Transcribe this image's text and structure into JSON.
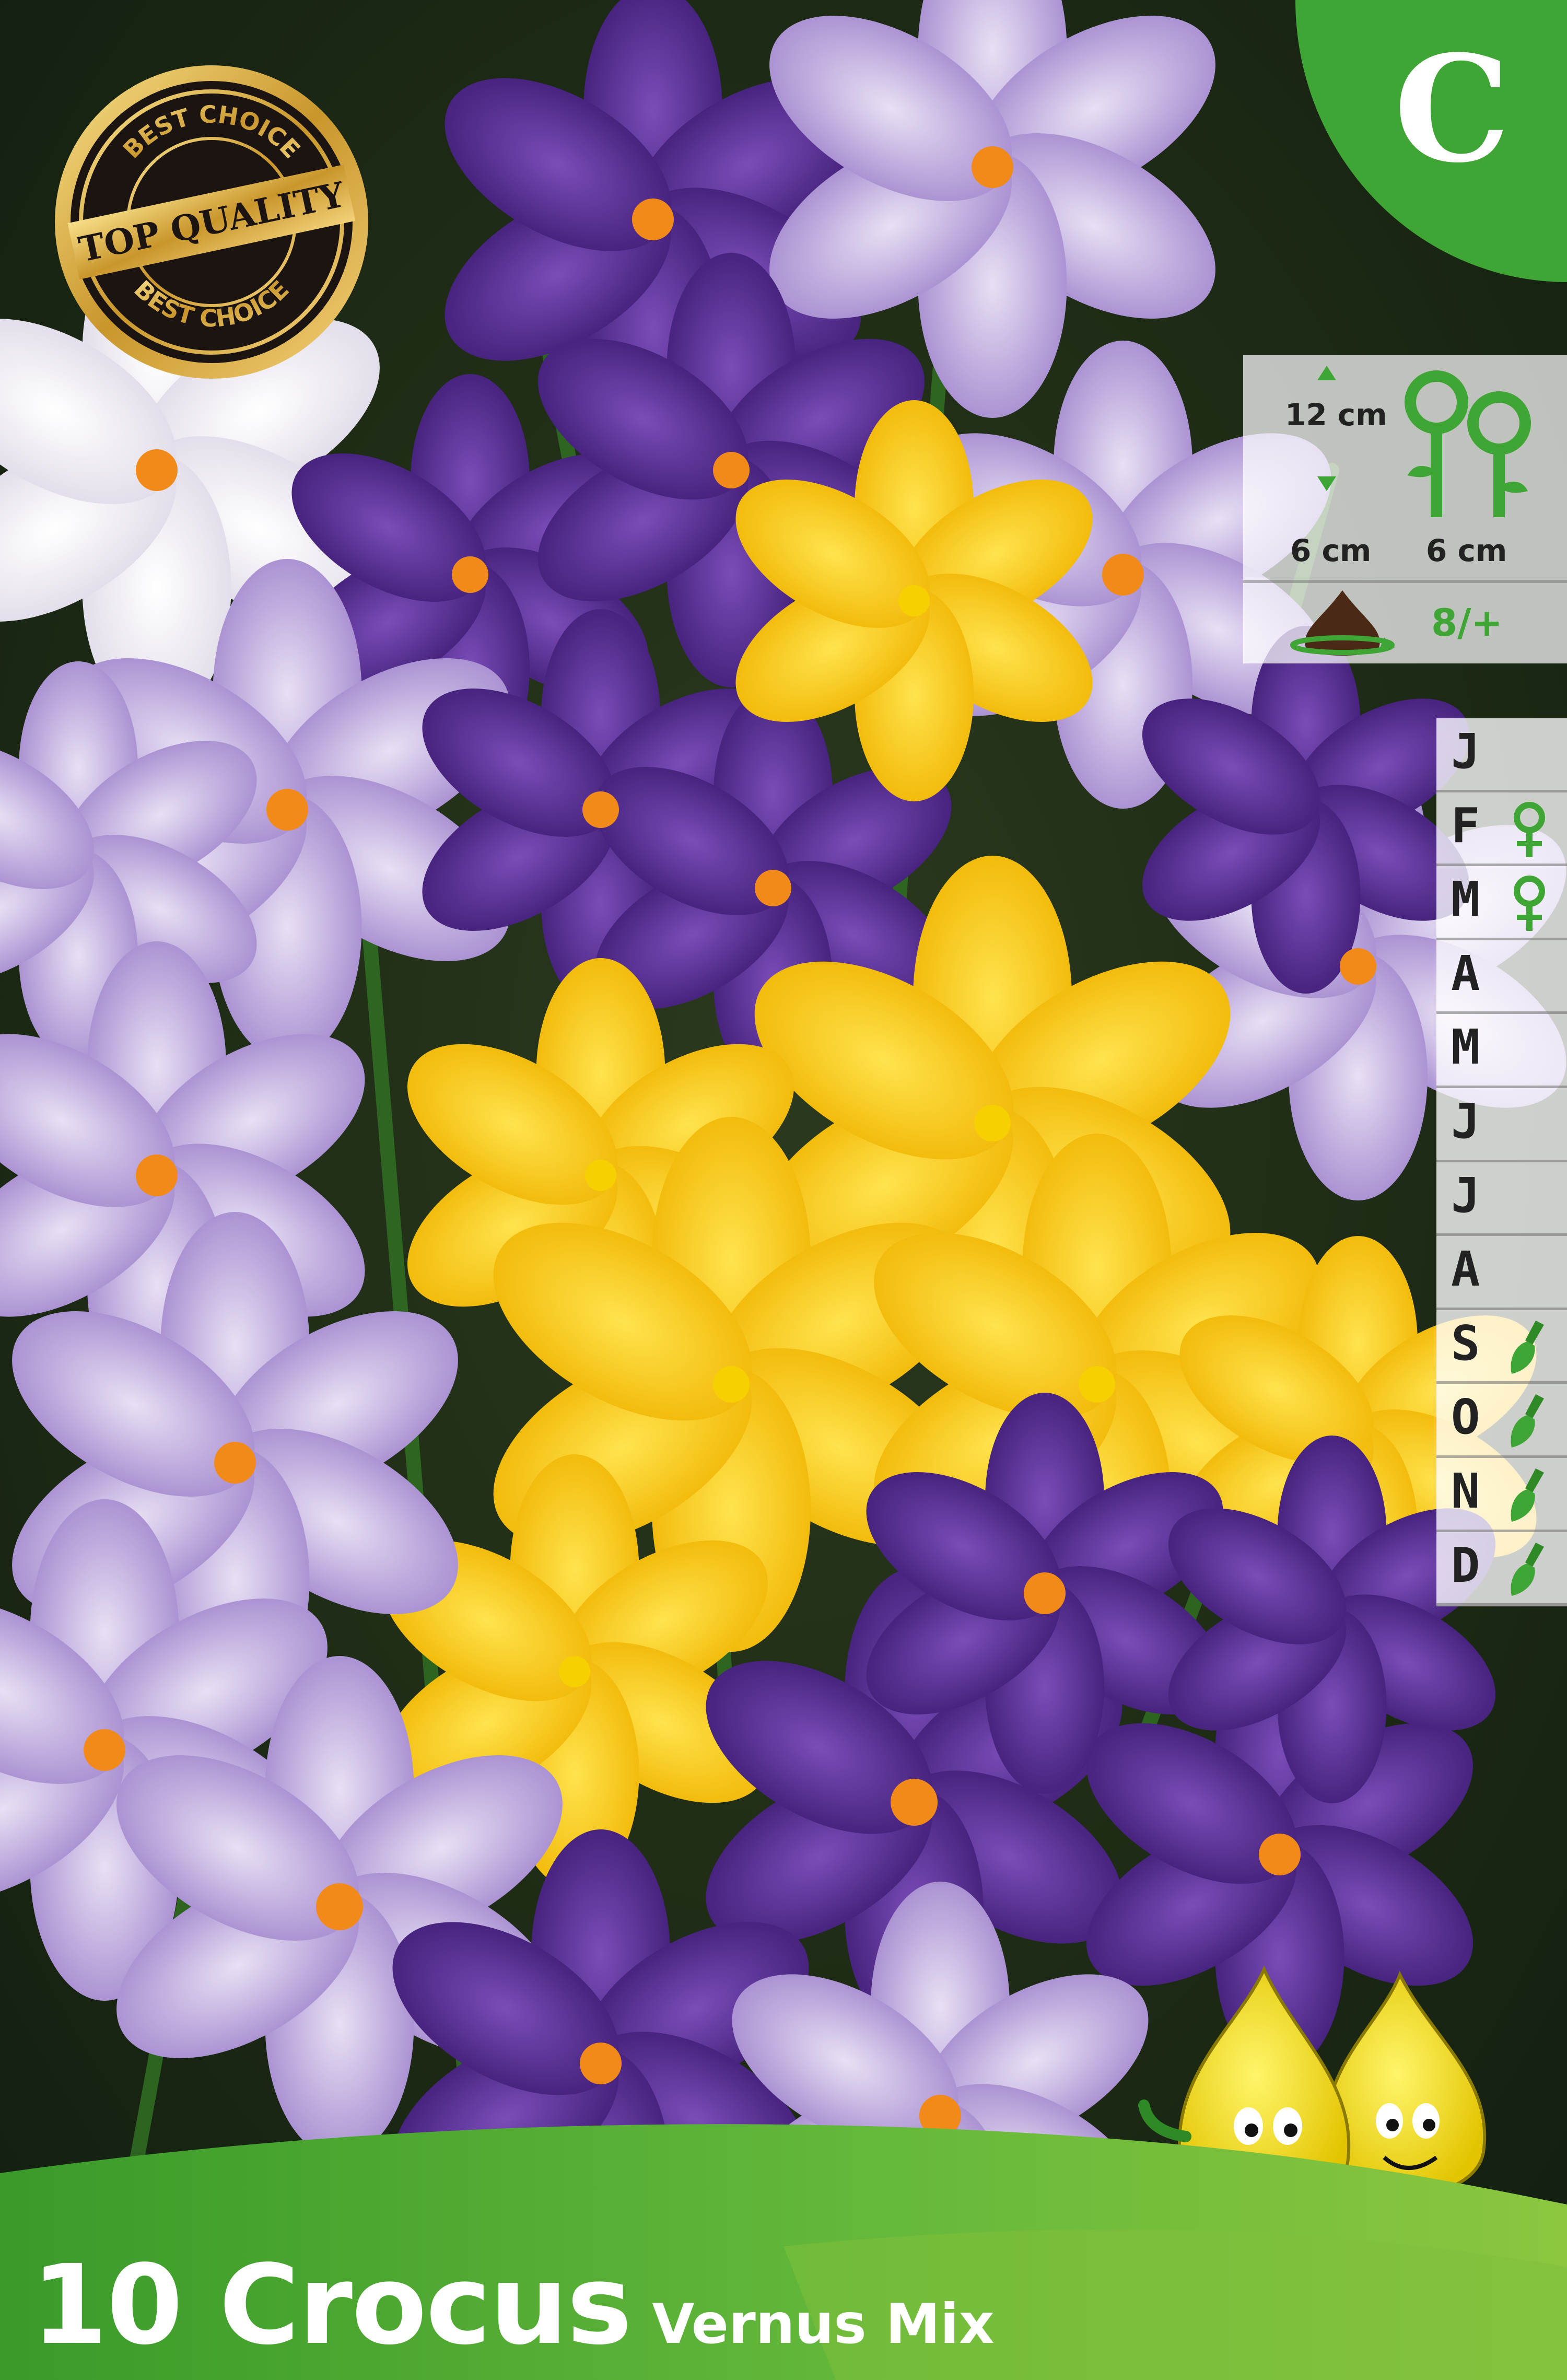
{
  "badge": {
    "letter": "C",
    "color": "#3fa535"
  },
  "seal": {
    "top_text": "BEST CHOICE",
    "middle_text": "TOP QUALITY",
    "bottom_text": "BEST CHOICE"
  },
  "planting_info": {
    "height": "12 cm",
    "depth": "6 cm",
    "spacing": "6 cm",
    "bulbs_per_hole": "8/+",
    "icons": [
      "height-arrow-icon",
      "flowers-icon",
      "bulb-icon",
      "rotate-arrow-icon"
    ]
  },
  "calendar": {
    "months": [
      {
        "letter": "J",
        "icon": ""
      },
      {
        "letter": "F",
        "icon": "flower-icon"
      },
      {
        "letter": "M",
        "icon": "flower-icon"
      },
      {
        "letter": "A",
        "icon": ""
      },
      {
        "letter": "M",
        "icon": ""
      },
      {
        "letter": "J",
        "icon": ""
      },
      {
        "letter": "J",
        "icon": ""
      },
      {
        "letter": "A",
        "icon": ""
      },
      {
        "letter": "S",
        "icon": "trowel-icon"
      },
      {
        "letter": "O",
        "icon": "trowel-icon"
      },
      {
        "letter": "N",
        "icon": "trowel-icon"
      },
      {
        "letter": "D",
        "icon": "trowel-icon"
      }
    ]
  },
  "product": {
    "title": "10 Crocus",
    "variety": "Vernus Mix"
  },
  "colors": {
    "green": "#3fa535",
    "yellow": "#f5c400",
    "purple": "#5a2d8c",
    "lilac": "#b9a2d8",
    "white": "#f5f2fa"
  }
}
